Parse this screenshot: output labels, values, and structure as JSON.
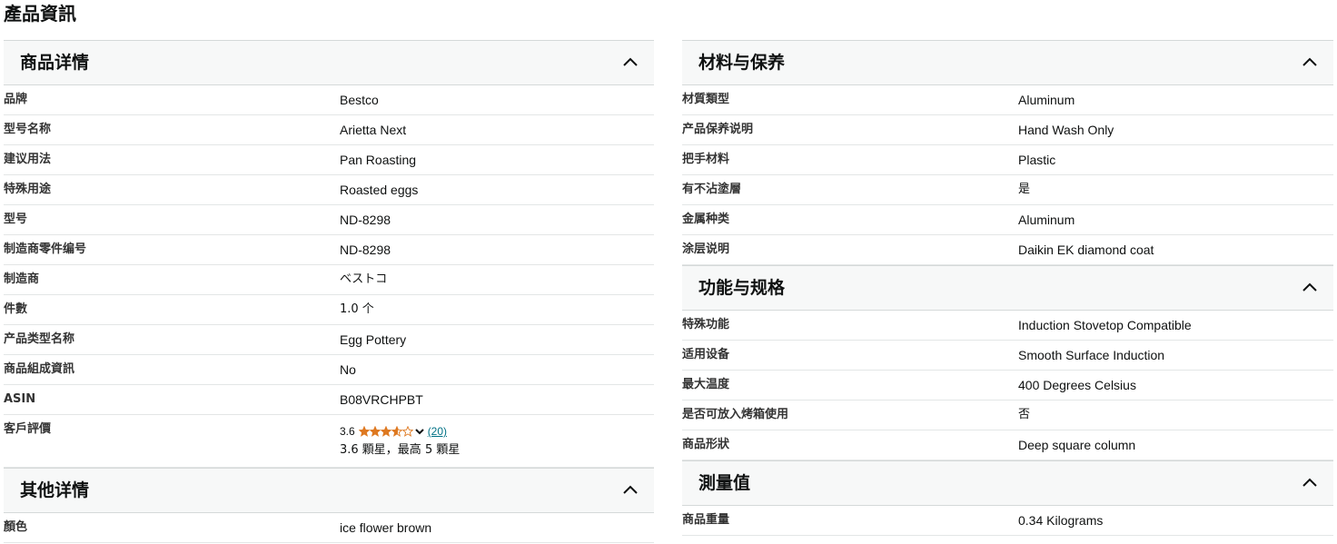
{
  "page_title": "產品資訊",
  "left": {
    "details": {
      "title": "商品详情",
      "rows": [
        {
          "label": "品牌",
          "value": "Bestco"
        },
        {
          "label": "型号名称",
          "value": "Arietta Next"
        },
        {
          "label": "建议用法",
          "value": "Pan Roasting"
        },
        {
          "label": "特殊用途",
          "value": "Roasted eggs"
        },
        {
          "label": "型号",
          "value": "ND-8298"
        },
        {
          "label": "制造商零件编号",
          "value": "ND-8298"
        },
        {
          "label": "制造商",
          "value": "ベストコ"
        },
        {
          "label": "件數",
          "value": "1.0 个"
        },
        {
          "label": "产品类型名称",
          "value": "Egg Pottery"
        },
        {
          "label": "商品組成資訊",
          "value": "No"
        },
        {
          "label": "ASIN",
          "value": "B08VRCHPBT"
        }
      ],
      "rating": {
        "label": "客戶評價",
        "score": "3.6",
        "stars_value": 3.6,
        "count": "(20)",
        "text": "3.6 顆星，最高 5 顆星"
      }
    },
    "other": {
      "title": "其他详情",
      "rows": [
        {
          "label": "顏色",
          "value": "ice flower brown"
        }
      ]
    }
  },
  "right": {
    "materials": {
      "title": "材料与保养",
      "rows": [
        {
          "label": "材質類型",
          "value": "Aluminum"
        },
        {
          "label": "产品保养说明",
          "value": "Hand Wash Only"
        },
        {
          "label": "把手材料",
          "value": "Plastic"
        },
        {
          "label": "有不沾塗層",
          "value": "是"
        },
        {
          "label": "金属种类",
          "value": "Aluminum"
        },
        {
          "label": "涂层说明",
          "value": "Daikin EK diamond coat"
        }
      ]
    },
    "features": {
      "title": "功能与规格",
      "rows": [
        {
          "label": "特殊功能",
          "value": "Induction Stovetop Compatible"
        },
        {
          "label": "适用设备",
          "value": "Smooth Surface Induction"
        },
        {
          "label": "最大温度",
          "value": "400 Degrees Celsius"
        },
        {
          "label": "是否可放入烤箱使用",
          "value": "否"
        },
        {
          "label": "商品形狀",
          "value": "Deep square column"
        }
      ]
    },
    "measurements": {
      "title": "測量值",
      "rows": [
        {
          "label": "商品重量",
          "value": "0.34 Kilograms"
        }
      ]
    }
  },
  "colors": {
    "star": "#de7921",
    "link": "#007185"
  },
  "icons": {
    "collapse": "chevron-up-icon",
    "star": "star-icon"
  }
}
